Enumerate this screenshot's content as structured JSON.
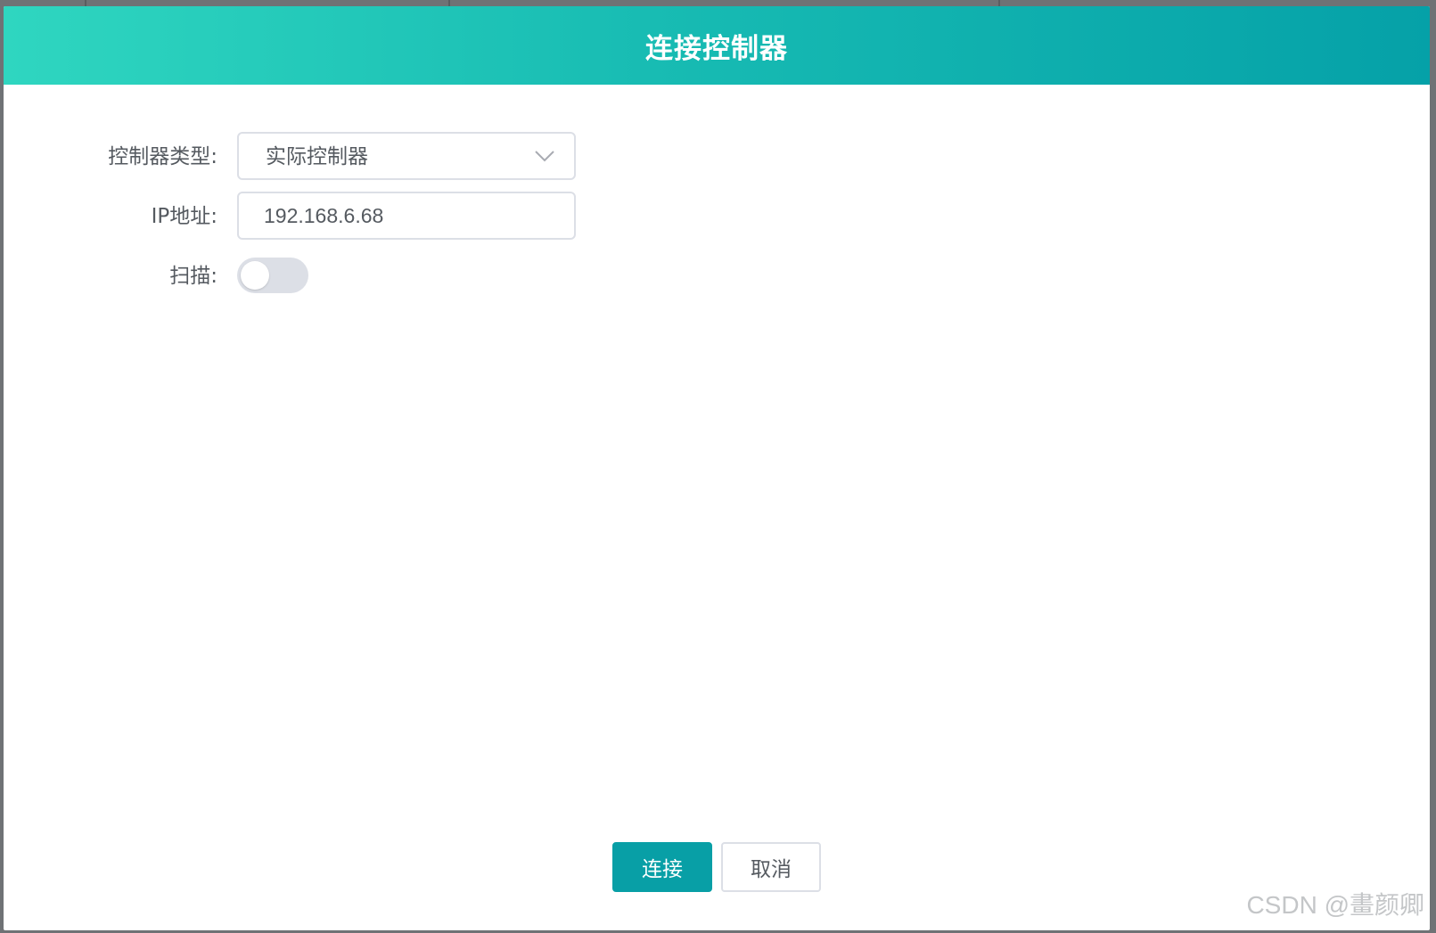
{
  "dialog": {
    "title": "连接控制器"
  },
  "form": {
    "controller_type": {
      "label": "控制器类型:",
      "value": "实际控制器"
    },
    "ip": {
      "label": "IP地址:",
      "value": "192.168.6.68"
    },
    "scan": {
      "label": "扫描:",
      "enabled": false
    }
  },
  "buttons": {
    "connect": "连接",
    "cancel": "取消"
  },
  "watermark": "CSDN @畫颜卿",
  "colors": {
    "header_gradient_start": "#2fd6c0",
    "header_gradient_end": "#05a1a8",
    "primary_button": "#089fa6",
    "switch_off": "#dcdfe6"
  },
  "icons": {
    "select_arrow": "chevron-down-icon"
  }
}
